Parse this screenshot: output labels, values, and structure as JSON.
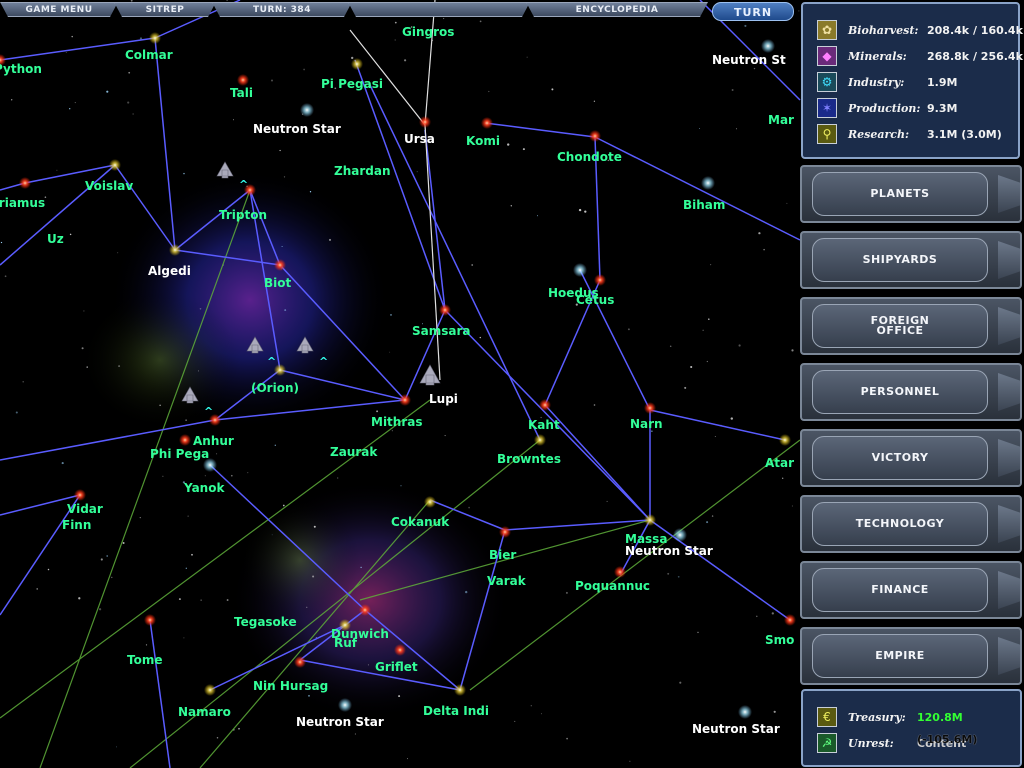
{
  "top_menu": {
    "game_menu": "GAME MENU",
    "sitrep": "SITREP",
    "turn": "TURN: 384",
    "blank": "",
    "encyclopedia": "ENCYCLOPEDIA",
    "turn_button": "TURN"
  },
  "resources": {
    "bioharvest": {
      "label": "Bioharvest:",
      "value": "208.4k / 160.4k",
      "icon": "bioharvest-icon"
    },
    "minerals": {
      "label": "Minerals:",
      "value": "268.8k / 256.4k",
      "icon": "minerals-icon"
    },
    "industry": {
      "label": "Industry:",
      "value": "1.9M",
      "icon": "industry-icon"
    },
    "production": {
      "label": "Production:",
      "value": "9.3M",
      "icon": "production-icon"
    },
    "research": {
      "label": "Research:",
      "value": "3.1M (3.0M)",
      "icon": "research-icon"
    }
  },
  "side_menu": {
    "planets": "PLANETS",
    "shipyards": "SHIPYARDS",
    "foreign_office_1": "FOREIGN",
    "foreign_office_2": "OFFICE",
    "personnel": "PERSONNEL",
    "victory": "VICTORY",
    "technology": "TECHNOLOGY",
    "finance": "FINANCE",
    "empire": "EMPIRE"
  },
  "treasury": {
    "treasury_label": "Treasury:",
    "treasury_value": "120.8M",
    "unrest_label": "Unrest:",
    "unrest_value": "Content",
    "unrest_overlay": "(-105.6M)",
    "treasury_color": "#33ff33"
  },
  "colors": {
    "star_label": "#33ff99",
    "neutron_label": "#ffffff",
    "lane_blue": "#5a5cff",
    "lane_green": "#5fae3a"
  },
  "stars": [
    {
      "name": "Python",
      "color": "cyan"
    },
    {
      "name": "Colmar",
      "color": "cyan"
    },
    {
      "name": "Tali",
      "color": "cyan"
    },
    {
      "name": "Pi Pegasi",
      "color": "cyan"
    },
    {
      "name": "Gingros",
      "color": "cyan"
    },
    {
      "name": "Neutron Star",
      "color": "white"
    },
    {
      "name": "Ursa",
      "color": "white"
    },
    {
      "name": "Komi",
      "color": "cyan"
    },
    {
      "name": "Chondote",
      "color": "cyan"
    },
    {
      "name": "Neutron St",
      "color": "white"
    },
    {
      "name": "Mar",
      "color": "cyan"
    },
    {
      "name": "Zhardan",
      "color": "cyan"
    },
    {
      "name": "Voislav",
      "color": "cyan"
    },
    {
      "name": "Priamus",
      "color": "cyan"
    },
    {
      "name": "Uz",
      "color": "cyan"
    },
    {
      "name": "Tripton",
      "color": "cyan"
    },
    {
      "name": "Biham",
      "color": "cyan"
    },
    {
      "name": "Algedi",
      "color": "white"
    },
    {
      "name": "Biot",
      "color": "cyan"
    },
    {
      "name": "Hoedus",
      "color": "cyan"
    },
    {
      "name": "Cetus",
      "color": "cyan"
    },
    {
      "name": "Samsara",
      "color": "cyan"
    },
    {
      "name": "(Orion)",
      "color": "cyan"
    },
    {
      "name": "Lupi",
      "color": "white"
    },
    {
      "name": "Mithras",
      "color": "cyan"
    },
    {
      "name": "Kaht",
      "color": "cyan"
    },
    {
      "name": "Narn",
      "color": "cyan"
    },
    {
      "name": "Anhur",
      "color": "cyan"
    },
    {
      "name": "Phi Pega",
      "color": "cyan"
    },
    {
      "name": "Zaurak",
      "color": "cyan"
    },
    {
      "name": "Browntes",
      "color": "cyan"
    },
    {
      "name": "Atar",
      "color": "cyan"
    },
    {
      "name": "Yanok",
      "color": "cyan"
    },
    {
      "name": "Vidar",
      "color": "cyan"
    },
    {
      "name": "Finn",
      "color": "cyan"
    },
    {
      "name": "Cokanuk",
      "color": "cyan"
    },
    {
      "name": "Massa",
      "color": "cyan"
    },
    {
      "name": "Neutron Star",
      "color": "white"
    },
    {
      "name": "Bier",
      "color": "cyan"
    },
    {
      "name": "Varak",
      "color": "cyan"
    },
    {
      "name": "Poquannuc",
      "color": "cyan"
    },
    {
      "name": "Tegasoke",
      "color": "cyan"
    },
    {
      "name": "Dunwich",
      "color": "cyan"
    },
    {
      "name": "Ruf",
      "color": "cyan"
    },
    {
      "name": "Tome",
      "color": "cyan"
    },
    {
      "name": "Griflet",
      "color": "cyan"
    },
    {
      "name": "Smo",
      "color": "cyan"
    },
    {
      "name": "Nin Hursag",
      "color": "cyan"
    },
    {
      "name": "Namaro",
      "color": "cyan"
    },
    {
      "name": "Neutron Star",
      "color": "white"
    },
    {
      "name": "Delta Indi",
      "color": "cyan"
    },
    {
      "name": "Neutron Star",
      "color": "white"
    }
  ]
}
